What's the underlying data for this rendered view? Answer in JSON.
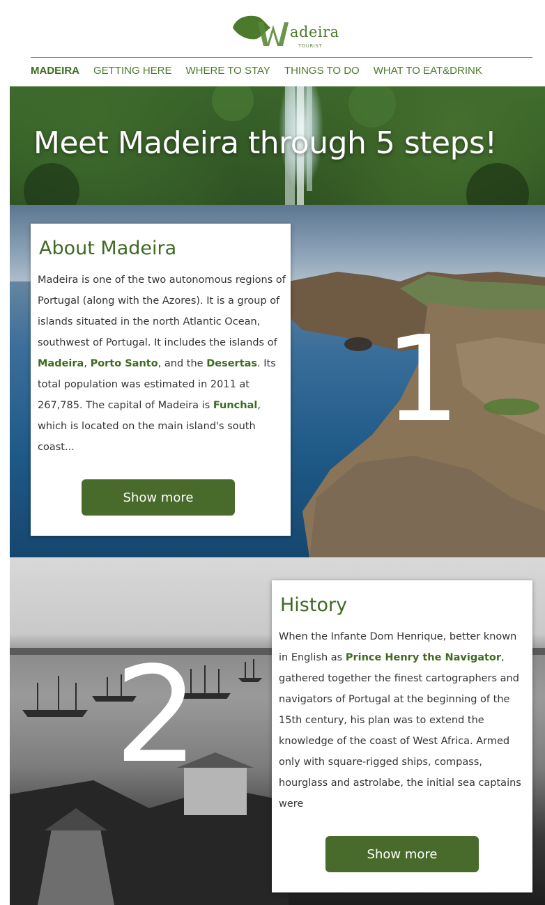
{
  "logo": {
    "word": "adeira",
    "sub": "TOURIST"
  },
  "nav": {
    "items": [
      {
        "label": "MADEIRA"
      },
      {
        "label": "GETTING HERE"
      },
      {
        "label": "WHERE TO STAY"
      },
      {
        "label": "THINGS TO DO"
      },
      {
        "label": "WHAT TO EAT&DRINK"
      }
    ]
  },
  "hero": {
    "title": "Meet Madeira through 5 steps!"
  },
  "about": {
    "number": "1",
    "title": "About Madeira",
    "text": {
      "t1": "Madeira is one of the two autonomous regions of Portugal (along with the Azores). It is a group of islands situated in the north Atlantic Ocean, southwest of Portugal. It includes the islands of ",
      "l1": "Madeira",
      "t2": ", ",
      "l2": "Porto Santo",
      "t3": ", and the ",
      "l3": "Desertas",
      "t4": ". Its total population was estimated in 2011 at 267,785. The capital of Madeira is ",
      "l4": "Funchal",
      "t5": ", which is located on the main island's south coast..."
    },
    "button": "Show more"
  },
  "history": {
    "number": "2",
    "title": "History",
    "text": {
      "t1": "When the Infante Dom Henrique, better known in English as ",
      "l1": "Prince Henry the Navigator",
      "t2": ", gathered together the finest cartographers and navigators of Portugal at the beginning of the 15th century, his plan was to extend the knowledge of the coast of West Africa. Armed only with square-rigged ships, compass, hourglass and astrolabe, the initial sea captains were"
    },
    "button": "Show more"
  },
  "colors": {
    "brand_green": "#3f6a22",
    "button_green": "#486b2b"
  }
}
